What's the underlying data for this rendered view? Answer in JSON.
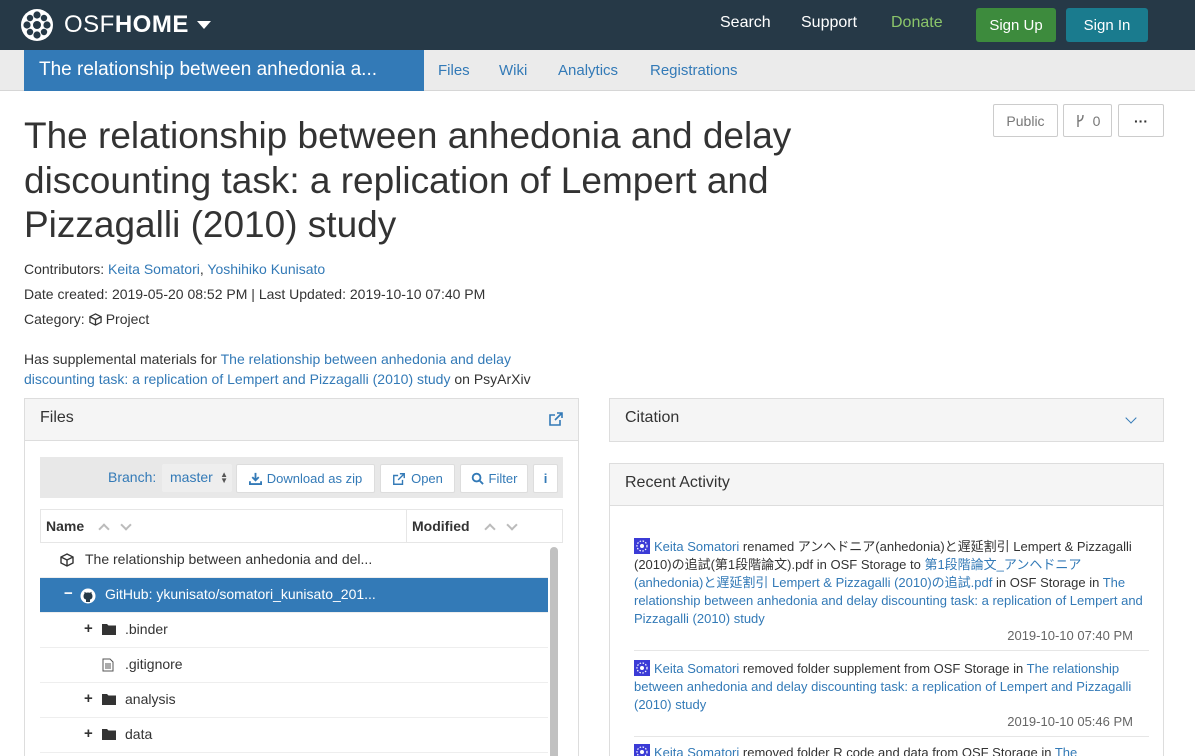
{
  "navbar": {
    "brand_osf": "OSF",
    "brand_home": "HOME",
    "links": {
      "search": "Search",
      "support": "Support",
      "donate": "Donate"
    },
    "signup": "Sign Up",
    "signin": "Sign In",
    "colors": {
      "bg": "#263947",
      "donate": "#8bc56a",
      "signup": "#3d8b3d",
      "signin": "#1a7b8e"
    }
  },
  "subnav": {
    "title": "The relationship between anhedonia a...",
    "tabs": [
      "Files",
      "Wiki",
      "Analytics",
      "Registrations"
    ]
  },
  "project": {
    "title": "The relationship between anhedonia and delay discounting task: a replication of Lempert and Pizzagalli (2010) study",
    "visibility": "Public",
    "fork_count": "0",
    "more": "···",
    "contributors_label": "Contributors:",
    "contributors": [
      "Keita Somatori",
      "Yoshihiko Kunisato"
    ],
    "date_created_label": "Date created:",
    "date_created": "2019-05-20 08:52 PM",
    "last_updated_label": "Last Updated:",
    "last_updated": "2019-10-10 07:40 PM",
    "category_label": "Category:",
    "category": "Project",
    "supp_prefix": "Has supplemental materials for",
    "supp_link": "The relationship between anhedonia and delay discounting task: a replication of Lempert and Pizzagalli (2010) study",
    "supp_suffix": "on PsyArXiv"
  },
  "files": {
    "heading": "Files",
    "branch_label": "Branch:",
    "branch": "master",
    "download_zip": "Download as zip",
    "open": "Open",
    "filter": "Filter",
    "info": "i",
    "col_name": "Name",
    "col_modified": "Modified",
    "rows": [
      {
        "label": "The relationship between anhedonia and del...",
        "icon": "cube-icon",
        "toggle": ""
      },
      {
        "label": "GitHub: ykunisato/somatori_kunisato_201...",
        "icon": "github-icon",
        "toggle": "−"
      },
      {
        "label": ".binder",
        "icon": "folder-icon",
        "toggle": "+"
      },
      {
        "label": ".gitignore",
        "icon": "file-icon",
        "toggle": ""
      },
      {
        "label": "analysis",
        "icon": "folder-icon",
        "toggle": "+"
      },
      {
        "label": "data",
        "icon": "folder-icon",
        "toggle": "+"
      }
    ]
  },
  "citation": {
    "heading": "Citation"
  },
  "activity": {
    "heading": "Recent Activity",
    "items": [
      {
        "user": "Keita Somatori",
        "action1": "renamed アンヘドニア(anhedonia)と遅延割引 Lempert & Pizzagalli (2010)の追試(第1段階論文).pdf in OSF Storage to",
        "target": "第1段階論文_アンヘドニア(anhedonia)と遅延割引 Lempert & Pizzagalli (2010)の追試.pdf",
        "action2": "in OSF Storage in",
        "project": "The relationship between anhedonia and delay discounting task: a replication of Lempert and Pizzagalli (2010) study",
        "time": "2019-10-10 07:40 PM"
      },
      {
        "user": "Keita Somatori",
        "action1": "removed folder supplement from OSF Storage in",
        "project": "The relationship between anhedonia and delay discounting task: a replication of Lempert and Pizzagalli (2010) study",
        "time": "2019-10-10 05:46 PM"
      },
      {
        "user": "Keita Somatori",
        "action1": "removed folder R code and data from OSF Storage in",
        "project": "The"
      }
    ]
  }
}
